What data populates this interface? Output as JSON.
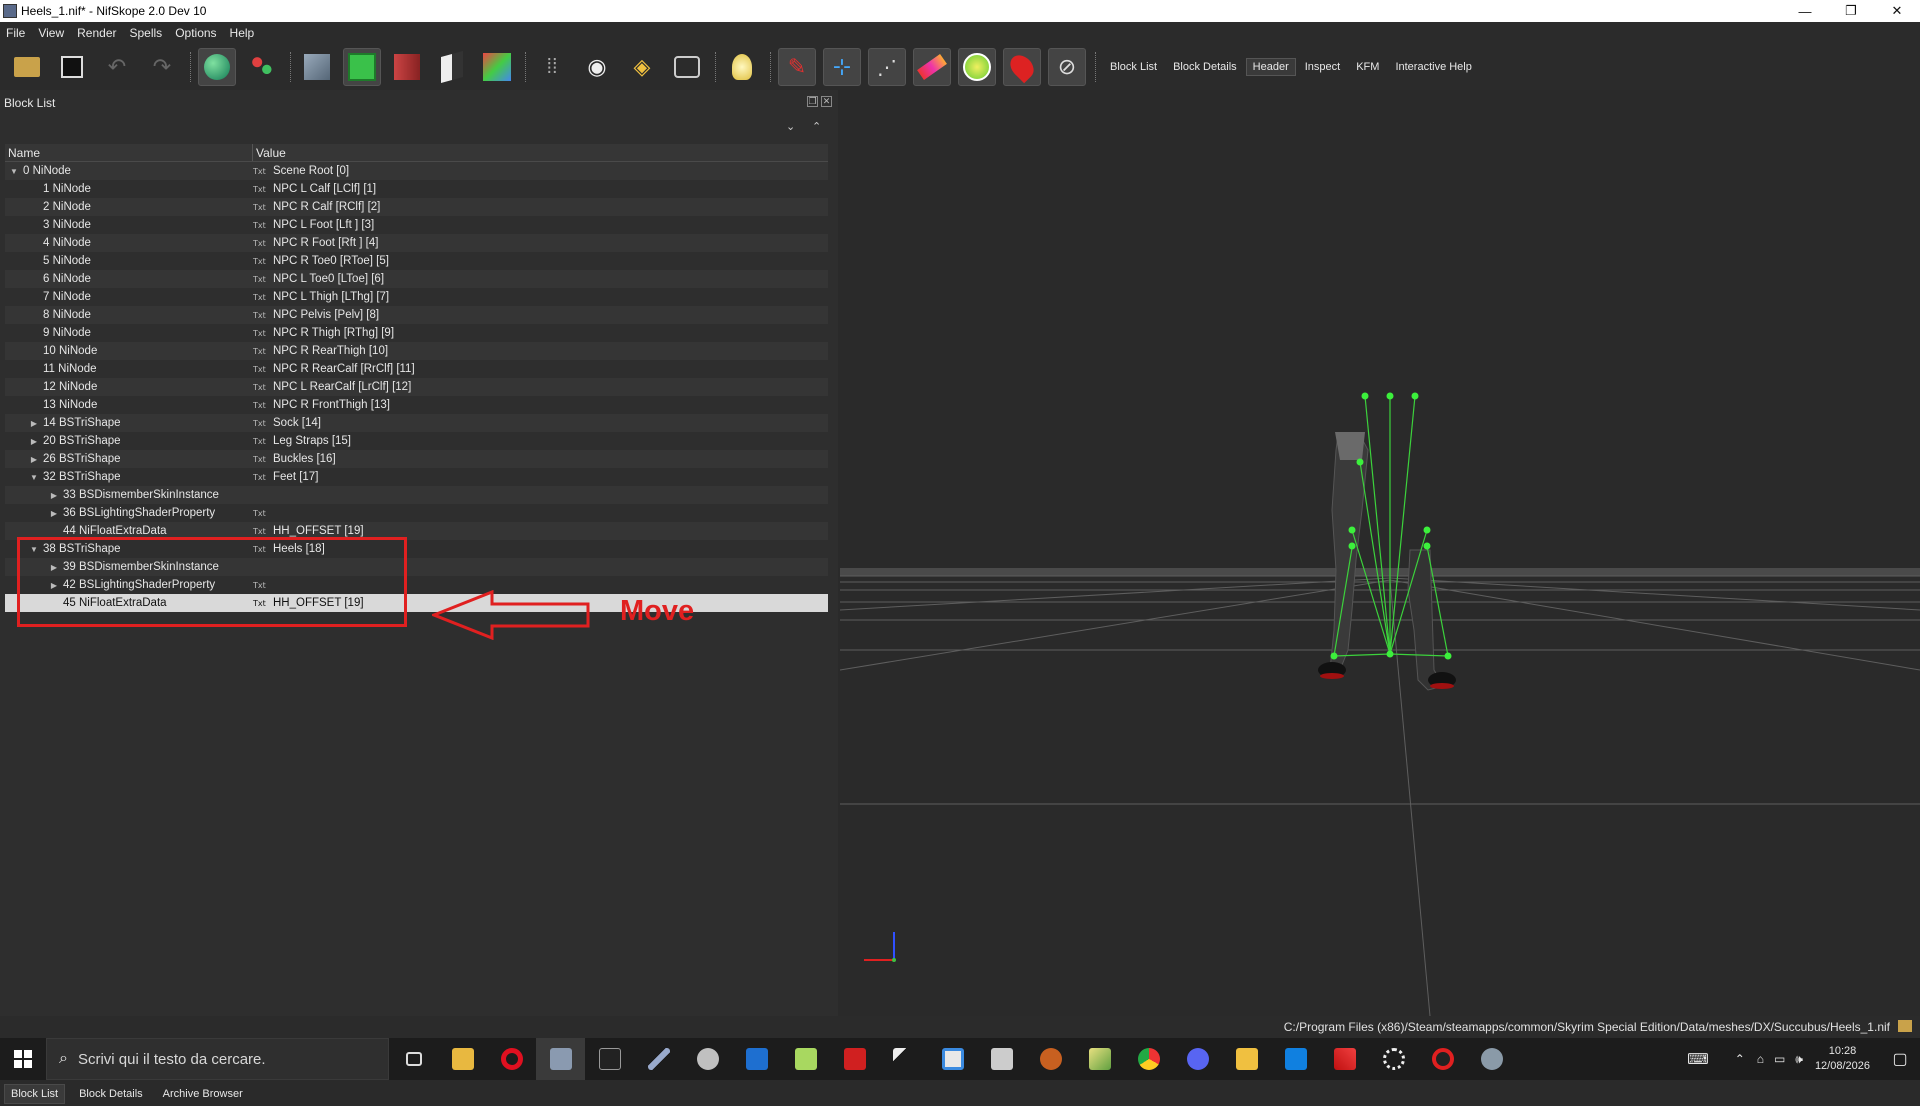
{
  "window": {
    "title": "Heels_1.nif* - NifSkope 2.0 Dev 10",
    "minimize": "—",
    "maximize": "❐",
    "close": "✕"
  },
  "menu": [
    "File",
    "View",
    "Render",
    "Spells",
    "Options",
    "Help"
  ],
  "toolbar": {
    "icons": [
      "load-icon",
      "save-icon",
      "undo-icon",
      "redo-icon",
      "select-object-icon",
      "select-vertex-icon",
      "view-front-icon",
      "view-top-icon",
      "view-side-icon",
      "view-user-icon",
      "view-walk-icon",
      "footsteps-icon",
      "eye-icon",
      "eye-hidden-icon",
      "screenshot-icon",
      "light-icon",
      "node-pin-icon",
      "axes-icon",
      "skeleton-icon",
      "gradient-icon",
      "gizmo-circle-icon",
      "marker-icon",
      "hide-icon"
    ],
    "tabs": [
      "Block List",
      "Block Details",
      "Header",
      "Inspect",
      "KFM",
      "Interactive Help"
    ],
    "active_tab": "Header"
  },
  "block_list": {
    "panel_title": "Block List",
    "columns": {
      "name": "Name",
      "value": "Value"
    },
    "txt_icon": "Txt",
    "rows": [
      {
        "name": "0 NiNode",
        "value": "Scene Root [0]",
        "indent": 0,
        "arrow": "▼"
      },
      {
        "name": "1 NiNode",
        "value": "NPC L Calf [LClf] [1]",
        "indent": 1,
        "arrow": ""
      },
      {
        "name": "2 NiNode",
        "value": "NPC R Calf [RClf] [2]",
        "indent": 1,
        "arrow": ""
      },
      {
        "name": "3 NiNode",
        "value": "NPC L Foot [Lft ] [3]",
        "indent": 1,
        "arrow": ""
      },
      {
        "name": "4 NiNode",
        "value": "NPC R Foot [Rft ] [4]",
        "indent": 1,
        "arrow": ""
      },
      {
        "name": "5 NiNode",
        "value": "NPC R Toe0 [RToe] [5]",
        "indent": 1,
        "arrow": ""
      },
      {
        "name": "6 NiNode",
        "value": "NPC L Toe0 [LToe] [6]",
        "indent": 1,
        "arrow": ""
      },
      {
        "name": "7 NiNode",
        "value": "NPC L Thigh [LThg] [7]",
        "indent": 1,
        "arrow": ""
      },
      {
        "name": "8 NiNode",
        "value": "NPC Pelvis [Pelv] [8]",
        "indent": 1,
        "arrow": ""
      },
      {
        "name": "9 NiNode",
        "value": "NPC R Thigh [RThg] [9]",
        "indent": 1,
        "arrow": ""
      },
      {
        "name": "10 NiNode",
        "value": "NPC R RearThigh [10]",
        "indent": 1,
        "arrow": ""
      },
      {
        "name": "11 NiNode",
        "value": "NPC R RearCalf [RrClf] [11]",
        "indent": 1,
        "arrow": ""
      },
      {
        "name": "12 NiNode",
        "value": "NPC L RearCalf [LrClf] [12]",
        "indent": 1,
        "arrow": ""
      },
      {
        "name": "13 NiNode",
        "value": "NPC R FrontThigh [13]",
        "indent": 1,
        "arrow": ""
      },
      {
        "name": "14 BSTriShape",
        "value": "Sock [14]",
        "indent": 1,
        "arrow": "▶"
      },
      {
        "name": "20 BSTriShape",
        "value": "Leg Straps [15]",
        "indent": 1,
        "arrow": "▶"
      },
      {
        "name": "26 BSTriShape",
        "value": "Buckles [16]",
        "indent": 1,
        "arrow": "▶"
      },
      {
        "name": "32 BSTriShape",
        "value": "Feet [17]",
        "indent": 1,
        "arrow": "▼"
      },
      {
        "name": "33 BSDismemberSkinInstance",
        "value": "",
        "indent": 2,
        "arrow": "▶"
      },
      {
        "name": "36 BSLightingShaderProperty",
        "value": "",
        "indent": 2,
        "arrow": "▶",
        "icon": true
      },
      {
        "name": "44 NiFloatExtraData",
        "value": "HH_OFFSET [19]",
        "indent": 2,
        "arrow": ""
      },
      {
        "name": "38 BSTriShape",
        "value": "Heels [18]",
        "indent": 1,
        "arrow": "▼"
      },
      {
        "name": "39 BSDismemberSkinInstance",
        "value": "",
        "indent": 2,
        "arrow": "▶"
      },
      {
        "name": "42 BSLightingShaderProperty",
        "value": "",
        "indent": 2,
        "arrow": "▶",
        "icon": true
      },
      {
        "name": "45 NiFloatExtraData",
        "value": "HH_OFFSET [19]",
        "indent": 2,
        "arrow": "",
        "selected": true
      }
    ]
  },
  "annotation": {
    "label": "Move",
    "color": "#e02020"
  },
  "bottom_tabs": [
    "Block List",
    "Block Details",
    "Archive Browser"
  ],
  "status": {
    "path": "C:/Program Files (x86)/Steam/steamapps/common/Skyrim Special Edition/Data/meshes/DX/Succubus/Heels_1.nif"
  },
  "taskbar": {
    "search_placeholder": "Scrivi qui il testo da cercare.",
    "apps": [
      "task-view-icon",
      "file-explorer-icon",
      "opera-icon",
      "nifskope-icon",
      "terminal-icon",
      "pen-icon",
      "blender-icon",
      "store-icon",
      "notepad-icon",
      "filezilla-icon",
      "chevron-app-icon",
      "window-app-icon",
      "calculator-icon",
      "game-icon",
      "photos-icon",
      "chrome-icon",
      "discord-icon",
      "folder-icon",
      "app-blue-icon",
      "app-red-icon",
      "settings-gear-icon",
      "target-icon",
      "steam-icon"
    ],
    "time": "10:28",
    "date": "12/08/2026"
  }
}
